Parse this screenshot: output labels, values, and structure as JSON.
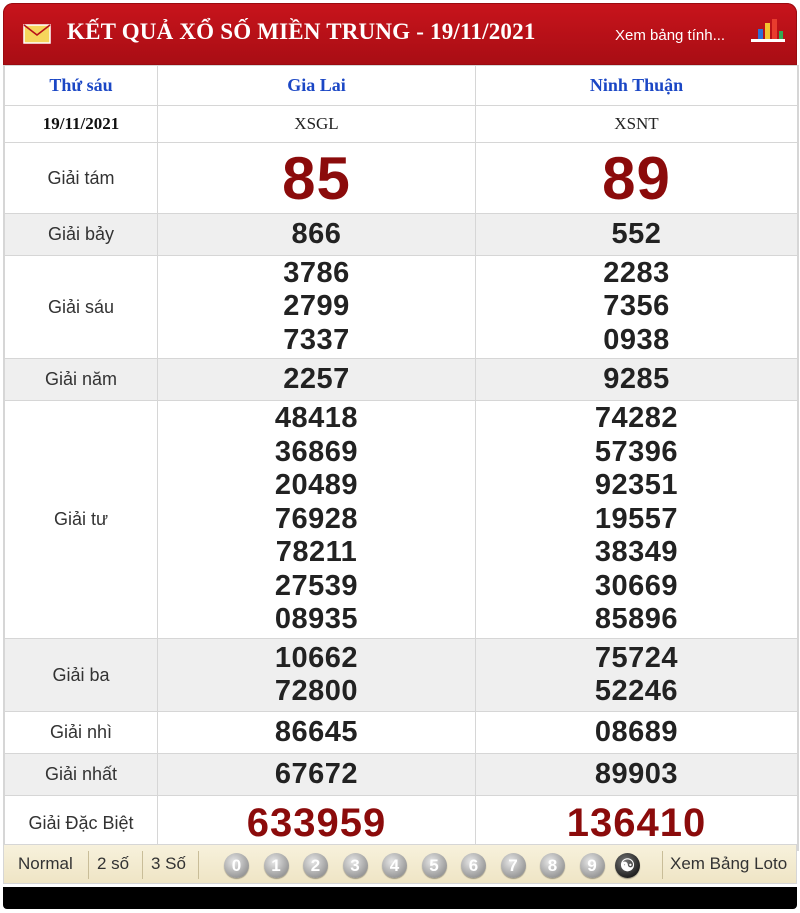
{
  "header": {
    "title": "KẾT QUẢ XỔ SỐ MIỀN TRUNG - 19/11/2021",
    "view_link": "Xem bảng tính...",
    "icons": [
      "mail-icon",
      "bar-chart-icon"
    ]
  },
  "table": {
    "day": "Thứ sáu",
    "date": "19/11/2021",
    "provinces": [
      {
        "name": "Gia Lai",
        "code": "XSGL"
      },
      {
        "name": "Ninh Thuận",
        "code": "XSNT"
      }
    ],
    "prizes": [
      {
        "label": "Giải tám",
        "values": [
          [
            "85"
          ],
          [
            "89"
          ]
        ]
      },
      {
        "label": "Giải bảy",
        "values": [
          [
            "866"
          ],
          [
            "552"
          ]
        ]
      },
      {
        "label": "Giải sáu",
        "values": [
          [
            "3786",
            "2799",
            "7337"
          ],
          [
            "2283",
            "7356",
            "0938"
          ]
        ]
      },
      {
        "label": "Giải năm",
        "values": [
          [
            "2257"
          ],
          [
            "9285"
          ]
        ]
      },
      {
        "label": "Giải tư",
        "values": [
          [
            "48418",
            "36869",
            "20489",
            "76928",
            "78211",
            "27539",
            "08935"
          ],
          [
            "74282",
            "57396",
            "92351",
            "19557",
            "38349",
            "30669",
            "85896"
          ]
        ]
      },
      {
        "label": "Giải ba",
        "values": [
          [
            "10662",
            "72800"
          ],
          [
            "75724",
            "52246"
          ]
        ]
      },
      {
        "label": "Giải nhì",
        "values": [
          [
            "86645"
          ],
          [
            "08689"
          ]
        ]
      },
      {
        "label": "Giải nhất",
        "values": [
          [
            "67672"
          ],
          [
            "89903"
          ]
        ]
      },
      {
        "label": "Giải Đặc Biệt",
        "values": [
          [
            "633959"
          ],
          [
            "136410"
          ]
        ]
      }
    ]
  },
  "footer": {
    "modes": [
      "Normal",
      "2 số",
      "3 Số"
    ],
    "digits": [
      "0",
      "1",
      "2",
      "3",
      "4",
      "5",
      "6",
      "7",
      "8",
      "9"
    ],
    "view_loto": "Xem Bảng Loto"
  },
  "colors": {
    "header_red": "#b8101a",
    "prize_red": "#8b0b0b",
    "province_blue": "#1b47c5"
  }
}
